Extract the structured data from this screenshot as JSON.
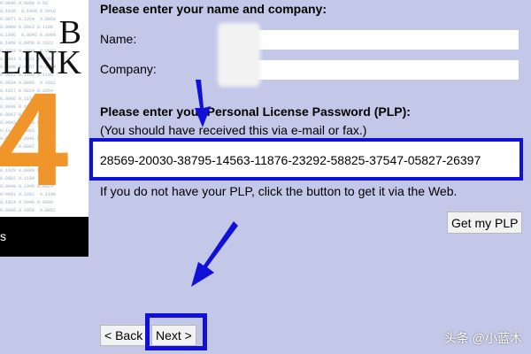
{
  "form": {
    "name_heading": "Please enter your name and company:",
    "name_label": "Name:",
    "company_label": "Company:",
    "name_value": "",
    "company_value": "",
    "plp_heading": "Please enter your Personal License Password (PLP):",
    "plp_subtitle": "(You should have received this via e-mail or fax.)",
    "plp_value": "28569-20030-38795-14563-11876-23292-58825-37547-05827-26397",
    "plp_hint": "If you do not have your PLP, click the button to get it via the Web.",
    "get_plp_button": "Get my PLP"
  },
  "nav": {
    "back_button": "< Back",
    "next_button": "Next >"
  },
  "splash": {
    "brand_top": "B",
    "brand_bottom": "LINK",
    "version_digit": "4",
    "bar_text": "s"
  },
  "watermark": "头条 @小蓝木",
  "colors": {
    "background": "#c4c8e8",
    "highlight_border": "#1010d8",
    "splash_orange": "#f0952a"
  }
}
